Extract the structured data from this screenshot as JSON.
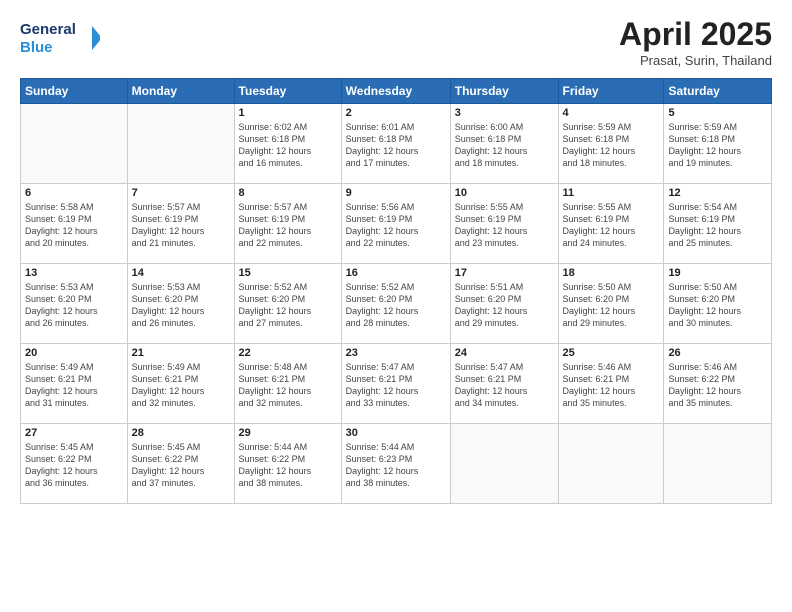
{
  "header": {
    "logo_line1": "General",
    "logo_line2": "Blue",
    "month_title": "April 2025",
    "location": "Prasat, Surin, Thailand"
  },
  "weekdays": [
    "Sunday",
    "Monday",
    "Tuesday",
    "Wednesday",
    "Thursday",
    "Friday",
    "Saturday"
  ],
  "weeks": [
    [
      {
        "day": "",
        "info": ""
      },
      {
        "day": "",
        "info": ""
      },
      {
        "day": "1",
        "info": "Sunrise: 6:02 AM\nSunset: 6:18 PM\nDaylight: 12 hours\nand 16 minutes."
      },
      {
        "day": "2",
        "info": "Sunrise: 6:01 AM\nSunset: 6:18 PM\nDaylight: 12 hours\nand 17 minutes."
      },
      {
        "day": "3",
        "info": "Sunrise: 6:00 AM\nSunset: 6:18 PM\nDaylight: 12 hours\nand 18 minutes."
      },
      {
        "day": "4",
        "info": "Sunrise: 5:59 AM\nSunset: 6:18 PM\nDaylight: 12 hours\nand 18 minutes."
      },
      {
        "day": "5",
        "info": "Sunrise: 5:59 AM\nSunset: 6:18 PM\nDaylight: 12 hours\nand 19 minutes."
      }
    ],
    [
      {
        "day": "6",
        "info": "Sunrise: 5:58 AM\nSunset: 6:19 PM\nDaylight: 12 hours\nand 20 minutes."
      },
      {
        "day": "7",
        "info": "Sunrise: 5:57 AM\nSunset: 6:19 PM\nDaylight: 12 hours\nand 21 minutes."
      },
      {
        "day": "8",
        "info": "Sunrise: 5:57 AM\nSunset: 6:19 PM\nDaylight: 12 hours\nand 22 minutes."
      },
      {
        "day": "9",
        "info": "Sunrise: 5:56 AM\nSunset: 6:19 PM\nDaylight: 12 hours\nand 22 minutes."
      },
      {
        "day": "10",
        "info": "Sunrise: 5:55 AM\nSunset: 6:19 PM\nDaylight: 12 hours\nand 23 minutes."
      },
      {
        "day": "11",
        "info": "Sunrise: 5:55 AM\nSunset: 6:19 PM\nDaylight: 12 hours\nand 24 minutes."
      },
      {
        "day": "12",
        "info": "Sunrise: 5:54 AM\nSunset: 6:19 PM\nDaylight: 12 hours\nand 25 minutes."
      }
    ],
    [
      {
        "day": "13",
        "info": "Sunrise: 5:53 AM\nSunset: 6:20 PM\nDaylight: 12 hours\nand 26 minutes."
      },
      {
        "day": "14",
        "info": "Sunrise: 5:53 AM\nSunset: 6:20 PM\nDaylight: 12 hours\nand 26 minutes."
      },
      {
        "day": "15",
        "info": "Sunrise: 5:52 AM\nSunset: 6:20 PM\nDaylight: 12 hours\nand 27 minutes."
      },
      {
        "day": "16",
        "info": "Sunrise: 5:52 AM\nSunset: 6:20 PM\nDaylight: 12 hours\nand 28 minutes."
      },
      {
        "day": "17",
        "info": "Sunrise: 5:51 AM\nSunset: 6:20 PM\nDaylight: 12 hours\nand 29 minutes."
      },
      {
        "day": "18",
        "info": "Sunrise: 5:50 AM\nSunset: 6:20 PM\nDaylight: 12 hours\nand 29 minutes."
      },
      {
        "day": "19",
        "info": "Sunrise: 5:50 AM\nSunset: 6:20 PM\nDaylight: 12 hours\nand 30 minutes."
      }
    ],
    [
      {
        "day": "20",
        "info": "Sunrise: 5:49 AM\nSunset: 6:21 PM\nDaylight: 12 hours\nand 31 minutes."
      },
      {
        "day": "21",
        "info": "Sunrise: 5:49 AM\nSunset: 6:21 PM\nDaylight: 12 hours\nand 32 minutes."
      },
      {
        "day": "22",
        "info": "Sunrise: 5:48 AM\nSunset: 6:21 PM\nDaylight: 12 hours\nand 32 minutes."
      },
      {
        "day": "23",
        "info": "Sunrise: 5:47 AM\nSunset: 6:21 PM\nDaylight: 12 hours\nand 33 minutes."
      },
      {
        "day": "24",
        "info": "Sunrise: 5:47 AM\nSunset: 6:21 PM\nDaylight: 12 hours\nand 34 minutes."
      },
      {
        "day": "25",
        "info": "Sunrise: 5:46 AM\nSunset: 6:21 PM\nDaylight: 12 hours\nand 35 minutes."
      },
      {
        "day": "26",
        "info": "Sunrise: 5:46 AM\nSunset: 6:22 PM\nDaylight: 12 hours\nand 35 minutes."
      }
    ],
    [
      {
        "day": "27",
        "info": "Sunrise: 5:45 AM\nSunset: 6:22 PM\nDaylight: 12 hours\nand 36 minutes."
      },
      {
        "day": "28",
        "info": "Sunrise: 5:45 AM\nSunset: 6:22 PM\nDaylight: 12 hours\nand 37 minutes."
      },
      {
        "day": "29",
        "info": "Sunrise: 5:44 AM\nSunset: 6:22 PM\nDaylight: 12 hours\nand 38 minutes."
      },
      {
        "day": "30",
        "info": "Sunrise: 5:44 AM\nSunset: 6:23 PM\nDaylight: 12 hours\nand 38 minutes."
      },
      {
        "day": "",
        "info": ""
      },
      {
        "day": "",
        "info": ""
      },
      {
        "day": "",
        "info": ""
      }
    ]
  ]
}
